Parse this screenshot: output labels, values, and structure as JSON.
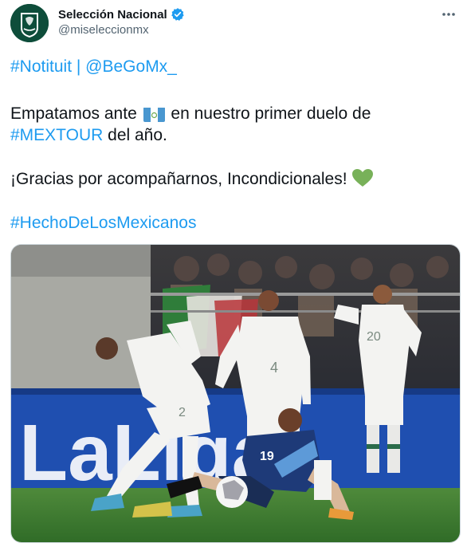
{
  "author": {
    "display_name": "Selección Nacional",
    "handle": "@miseleccionmx",
    "verified": true,
    "avatar_icon": "mexico-crest-icon"
  },
  "tweet": {
    "mention_tag": "#Notituit",
    "separator": " | ",
    "mention_user": "@BeGoMx_",
    "line1_before_flag": "Empatamos ante ",
    "flag_icon": "guatemala-flag-icon",
    "line1_after_flag": " en nuestro primer duelo de",
    "hashtag_mextour": "#MEXTOUR",
    "line2_rest": " del año.",
    "line3": "¡Gracias por acompañarnos, Incondicionales! ",
    "heart_icon": "green-heart-icon",
    "hashtag_final": "#HechoDeLosMexicanos"
  },
  "media": {
    "jersey_numbers": [
      "2",
      "4",
      "20",
      "19"
    ],
    "banner_text": "LaLiga"
  },
  "colors": {
    "link": "#1d9bf0",
    "text": "#0f1419",
    "secondary": "#536471",
    "verified": "#1d9bf0",
    "heart": "#78b159"
  }
}
